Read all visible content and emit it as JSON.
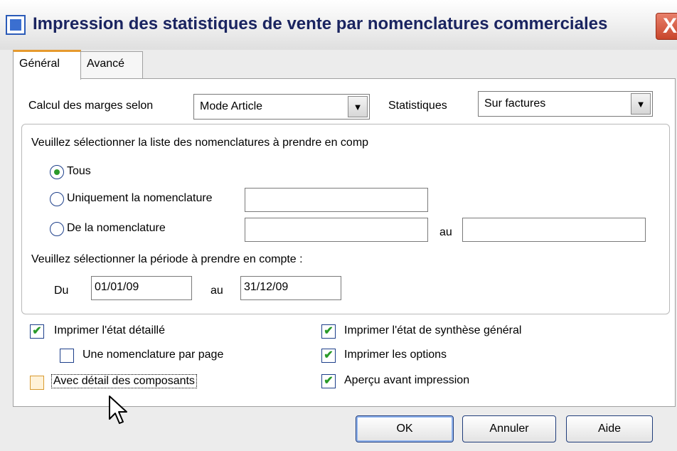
{
  "window": {
    "title": "Impression des statistiques de vente par nomenclatures commerciales",
    "close_glyph": "X"
  },
  "tabs": [
    {
      "label": "Général",
      "active": true
    },
    {
      "label": "Avancé",
      "active": false
    }
  ],
  "margins": {
    "label": "Calcul des marges selon",
    "value": "Mode Article"
  },
  "statistiques": {
    "label": "Statistiques",
    "value": "Sur factures"
  },
  "nomenclature_group": {
    "prompt": "Veuillez sélectionner la liste des nomenclatures à prendre en comp",
    "options": [
      {
        "label": "Tous",
        "checked": true
      },
      {
        "label": "Uniquement la nomenclature",
        "checked": false
      },
      {
        "label": "De la nomenclature",
        "checked": false
      }
    ],
    "uniquement_value": "",
    "from_value": "",
    "to_label": "au",
    "to_value": ""
  },
  "period": {
    "prompt": "Veuillez sélectionner la période à prendre en compte :",
    "from_label": "Du",
    "from_value": "01/01/09",
    "to_label": "au",
    "to_value": "31/12/09"
  },
  "options_left": [
    {
      "label": "Imprimer l'état détaillé",
      "checked": true
    },
    {
      "label": "Une nomenclature par page",
      "checked": false
    },
    {
      "label": "Avec détail des composants",
      "checked": false,
      "focused": true
    }
  ],
  "options_right": [
    {
      "label": "Imprimer l'état de synthèse général",
      "checked": true
    },
    {
      "label": "Imprimer les options",
      "checked": true
    },
    {
      "label": "Aperçu avant impression",
      "checked": true
    }
  ],
  "buttons": {
    "ok": "OK",
    "cancel": "Annuler",
    "help": "Aide"
  },
  "icons": {
    "check_glyph": "✔",
    "dropdown_glyph": "▼"
  },
  "colors": {
    "title_text": "#1a2460",
    "check_green": "#2a9a2a",
    "tab_accent": "#e69a2e"
  }
}
